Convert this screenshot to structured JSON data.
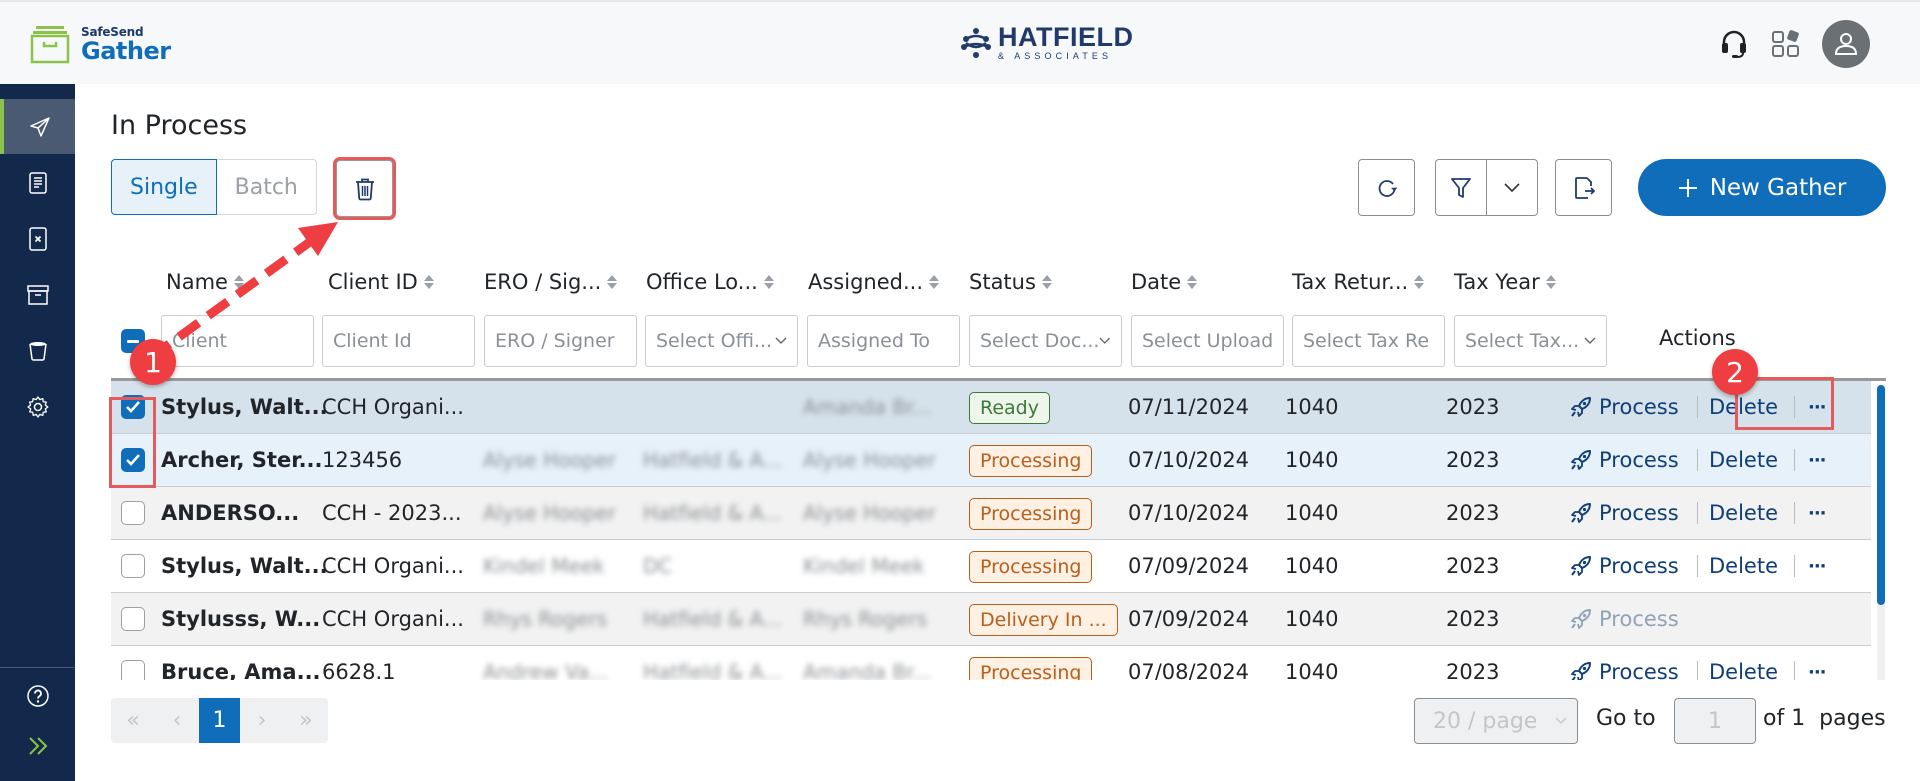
{
  "header": {
    "app_logo_small": "SafeSend",
    "app_logo_big": "Gather",
    "brand_name": "HATFIELD",
    "brand_sub": "& ASSOCIATES",
    "icons": [
      "headset-icon",
      "apps-grid-icon",
      "user-avatar-icon"
    ]
  },
  "sidebar": {
    "items": [
      {
        "icon": "send-icon",
        "active": true
      },
      {
        "icon": "document-icon",
        "active": false
      },
      {
        "icon": "document-x-icon",
        "active": false
      },
      {
        "icon": "archive-icon",
        "active": false
      },
      {
        "icon": "recycle-bin-icon",
        "active": false
      },
      {
        "icon": "gear-icon",
        "active": false
      }
    ],
    "bottom": [
      {
        "icon": "help-icon"
      },
      {
        "icon": "expand-chevrons-icon"
      }
    ]
  },
  "page": {
    "title": "In Process",
    "toggle": {
      "single": "Single",
      "batch": "Batch",
      "selected": "Single"
    },
    "new_button": "New Gather"
  },
  "table": {
    "columns": [
      "Name",
      "Client ID",
      "ERO / Sig...",
      "Office Lo...",
      "Assigned...",
      "Status",
      "Date",
      "Tax Retur...",
      "Tax Year"
    ],
    "actions_label": "Actions",
    "filters": {
      "name": "Client",
      "client_id": "Client Id",
      "ero": "ERO / Signer",
      "office": "Select Offi...",
      "assigned": "Assigned To",
      "status": "Select Doc...",
      "date": "Select Upload",
      "tax_return": "Select Tax Re",
      "tax_year": "Select Tax..."
    },
    "rows": [
      {
        "checked": true,
        "name": "Stylus, Walt...",
        "client_id": "CCH Organi...",
        "redacted": [
          "",
          "",
          "Amanda Br..."
        ],
        "status": "Ready",
        "status_type": "ready",
        "date": "07/11/2024",
        "tax_return": "1040",
        "tax_year": "2023",
        "process": "Process",
        "delete": "Delete",
        "more": "···",
        "process_enabled": true
      },
      {
        "checked": true,
        "name": "Archer, Ster...",
        "client_id": "123456",
        "redacted": [
          "Alyse Hooper",
          "Hatfield & A...",
          "Alyse Hooper"
        ],
        "status": "Processing",
        "status_type": "proc",
        "date": "07/10/2024",
        "tax_return": "1040",
        "tax_year": "2023",
        "process": "Process",
        "delete": "Delete",
        "more": "···",
        "process_enabled": true
      },
      {
        "checked": false,
        "name": "ANDERSO...",
        "client_id": "CCH - 2023...",
        "redacted": [
          "Alyse Hooper",
          "Hatfield & A...",
          "Alyse Hooper"
        ],
        "status": "Processing",
        "status_type": "proc",
        "date": "07/10/2024",
        "tax_return": "1040",
        "tax_year": "2023",
        "process": "Process",
        "delete": "Delete",
        "more": "···",
        "process_enabled": true
      },
      {
        "checked": false,
        "name": "Stylus, Walt...",
        "client_id": "CCH Organi...",
        "redacted": [
          "Kindel Meek",
          "DC",
          "Kindel Meek"
        ],
        "status": "Processing",
        "status_type": "proc",
        "date": "07/09/2024",
        "tax_return": "1040",
        "tax_year": "2023",
        "process": "Process",
        "delete": "Delete",
        "more": "···",
        "process_enabled": true
      },
      {
        "checked": false,
        "name": "Stylusss, W...",
        "client_id": "CCH Organi...",
        "redacted": [
          "Rhys Rogers",
          "Hatfield & A...",
          "Rhys Rogers"
        ],
        "status": "Delivery In ...",
        "status_type": "proc",
        "date": "07/09/2024",
        "tax_return": "1040",
        "tax_year": "2023",
        "process": "Process",
        "delete": "",
        "more": "",
        "process_enabled": false
      },
      {
        "checked": false,
        "name": "Bruce, Ama...",
        "client_id": "6628.1",
        "redacted": [
          "Andrew Va...",
          "Hatfield & A...",
          "Amanda Br..."
        ],
        "status": "Processing",
        "status_type": "proc",
        "date": "07/08/2024",
        "tax_return": "1040",
        "tax_year": "2023",
        "process": "Process",
        "delete": "Delete",
        "more": "···",
        "process_enabled": true
      }
    ]
  },
  "pagination": {
    "current_page": "1",
    "page_size": "20 / page",
    "goto_label": "Go to",
    "goto_value": "1",
    "of_label": "of 1  pages"
  },
  "annotations": {
    "step1": "1",
    "step2": "2"
  },
  "colors": {
    "primary": "#0f6dba",
    "sidebar": "#13294b",
    "accent_green": "#8bc34a",
    "annotation_red": "#ef3e42"
  }
}
